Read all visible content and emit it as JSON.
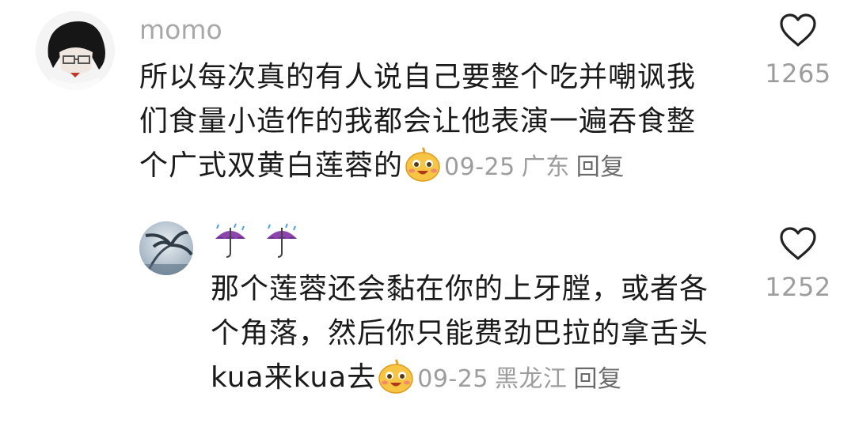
{
  "comments": [
    {
      "username": "momo",
      "text_lines": [
        "所以每次真的有人说自己要整个吃并嘲讽我",
        "们食量小造作的我都会让他表演一遍吞食整",
        "个广式双黄白莲蓉的"
      ],
      "emoji": "smiling-face-emoji",
      "date": "09-25",
      "location": "广东",
      "reply_label": "回复",
      "likes": "1265",
      "avatar": "anime-avatar-icon"
    },
    {
      "username_icons": [
        "umbrella-rain-icon",
        "umbrella-rain-icon"
      ],
      "text_lines": [
        "那个莲蓉还会黏在你的上牙膛，或者各",
        "个角落，然后你只能费劲巴拉的拿舌头",
        "kua来kua去"
      ],
      "emoji": "smiling-face-emoji",
      "date": "09-25",
      "location": "黑龙江",
      "reply_label": "回复",
      "likes": "1252",
      "avatar": "palm-tree-avatar-icon"
    }
  ],
  "colors": {
    "text": "#1a1a1a",
    "meta": "#9d9d9d",
    "username": "#a8a8a8",
    "heart_outline": "#222222"
  }
}
